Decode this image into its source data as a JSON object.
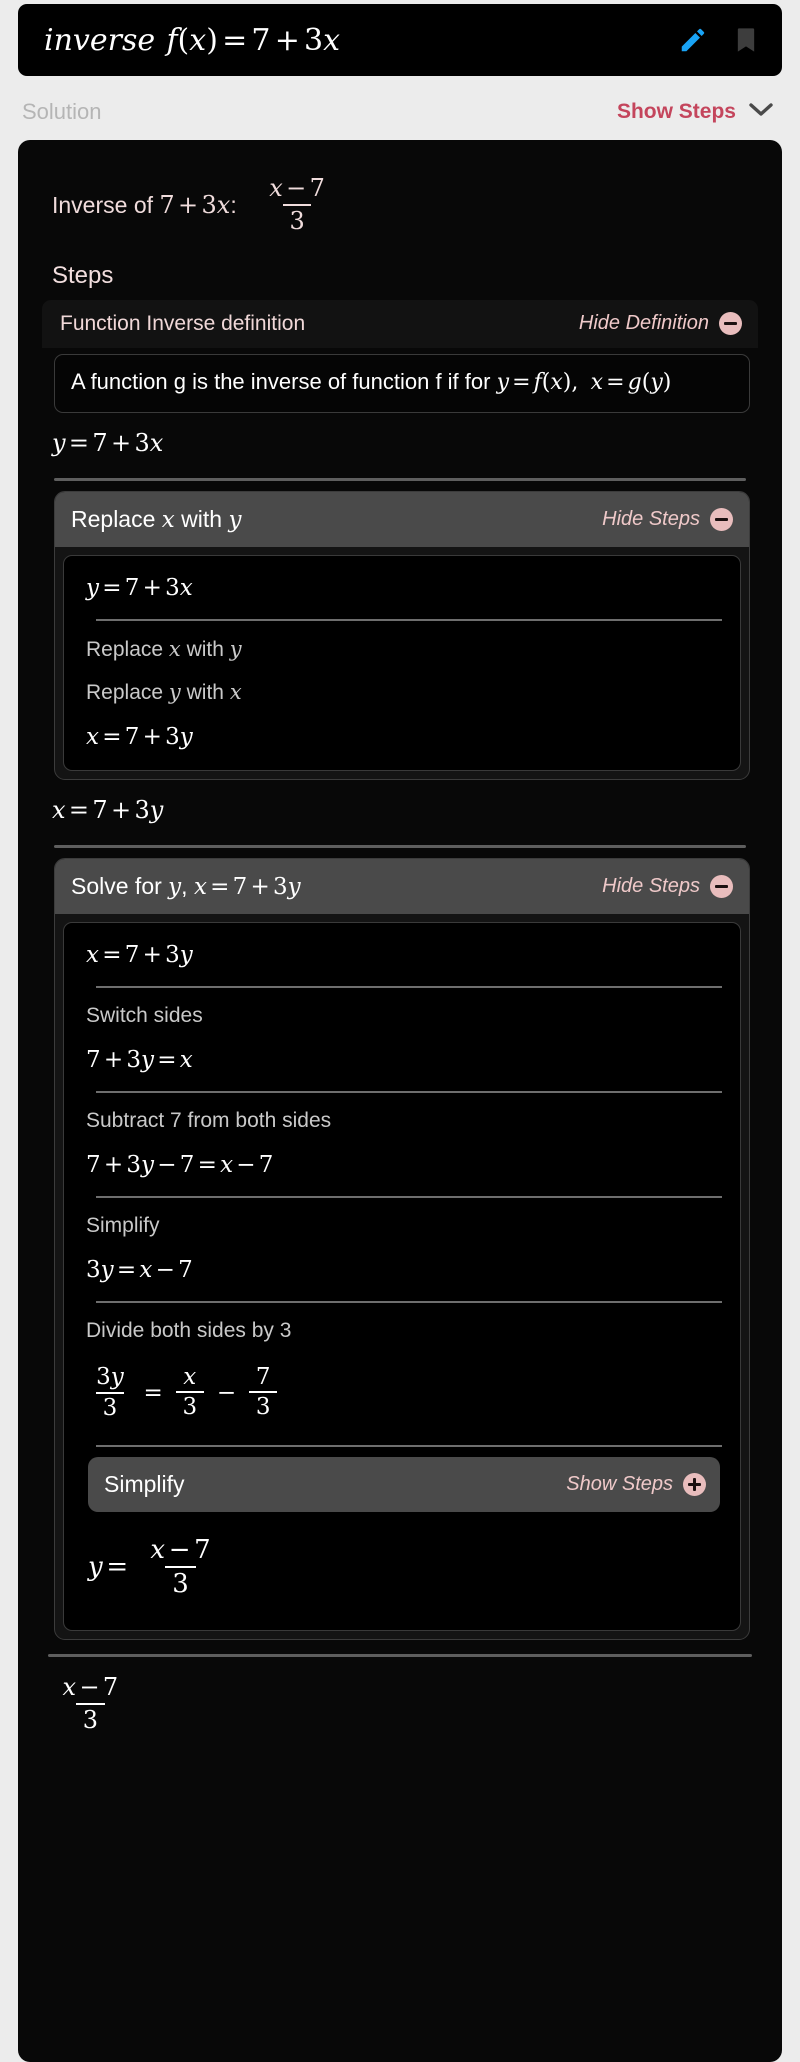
{
  "header": {
    "query_prefix": "inverse",
    "query_expression": "f(x) = 7 + 3x",
    "edit_icon": "pencil-icon",
    "bookmark_icon": "bookmark-icon",
    "accent_blue": "#19a3f5",
    "background": "#000000"
  },
  "solution_bar": {
    "title": "Solution",
    "show_steps_label": "Show Steps",
    "chevron_icon": "chevron-down-icon",
    "accent_crimson": "#c4455c",
    "background": "#ececec"
  },
  "solution": {
    "inverse_label": "Inverse of",
    "inverse_of_expr": "7 + 3x",
    "colon": ":",
    "result_numerator": "x − 7",
    "result_denominator": "3",
    "steps_title": "Steps"
  },
  "definition": {
    "title": "Function Inverse definition",
    "toggle_label": "Hide Definition",
    "toggle_icon": "minus-circle-icon",
    "text_part1": "A function g is the inverse of function f if for",
    "text_math1": "y = f(x),",
    "text_math2": "x = g(y)"
  },
  "equation_after_definition": "y = 7 + 3x",
  "panels": [
    {
      "title_text": "Replace x with y",
      "title_plain": "Replace",
      "toggle_label": "Hide Steps",
      "toggle_icon": "minus-circle-icon",
      "lead_equation": "y = 7 + 3x",
      "steps": [
        {
          "label": "Replace x with y",
          "equation": ""
        },
        {
          "label": "Replace y with x",
          "equation": ""
        }
      ],
      "result_equation": "x = 7 + 3y",
      "outer_result": "x = 7 + 3y"
    },
    {
      "title_text": "Solve for y, x = 7 + 3y",
      "toggle_label": "Hide Steps",
      "toggle_icon": "minus-circle-icon",
      "lead_equation": "x = 7 + 3y",
      "steps": [
        {
          "label": "Switch sides",
          "equation": "7 + 3y = x"
        },
        {
          "label": "Subtract 7 from both sides",
          "equation": "7 + 3y − 7 = x − 7"
        },
        {
          "label": "Simplify",
          "equation": "3y = x − 7"
        },
        {
          "label": "Divide both sides by 3",
          "equation": "3y/3 = x/3 − 7/3"
        }
      ],
      "subpanel": {
        "title": "Simplify",
        "toggle_label": "Show Steps",
        "toggle_icon": "plus-circle-icon"
      },
      "final_equation": "y = (x − 7)/3"
    }
  ],
  "tail_result": {
    "numerator": "x − 7",
    "denominator": "3"
  },
  "labels": {
    "replace_x_with": "Replace",
    "with": "with",
    "solve_for": "Solve for",
    "comma": ","
  }
}
